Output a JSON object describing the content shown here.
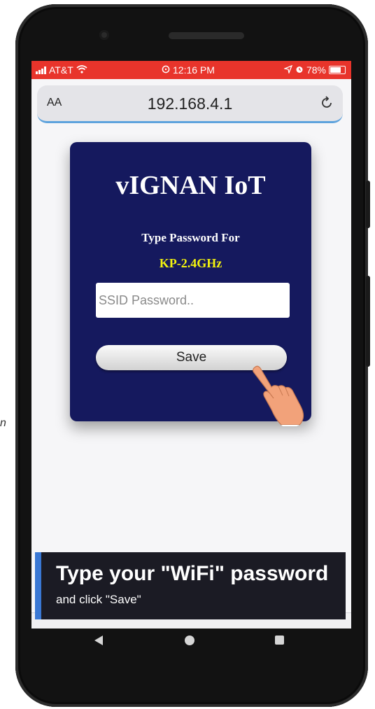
{
  "status_bar": {
    "carrier": "AT&T",
    "time": "12:16 PM",
    "battery": "78%"
  },
  "browser": {
    "text_size_label": "AA",
    "url": "192.168.4.1"
  },
  "card": {
    "brand": "vIGNAN IoT",
    "prompt": "Type Password For",
    "ssid": "KP-2.4GHz",
    "password_placeholder": "SSID Password..",
    "save_label": "Save"
  },
  "caption": {
    "title": "Type your \"WiFi\" password",
    "subtitle": "and click \"Save\""
  },
  "colors": {
    "status_bar": "#e8342b",
    "card_bg": "#15195e",
    "ssid_text": "#f4f40e",
    "caption_accent": "#3a78d4"
  },
  "icons": {
    "wifi": "wifi-icon",
    "alarm": "alarm-icon",
    "location": "location-arrow-icon",
    "reload": "reload-icon",
    "pointing_hand": "pointing-hand-icon"
  }
}
